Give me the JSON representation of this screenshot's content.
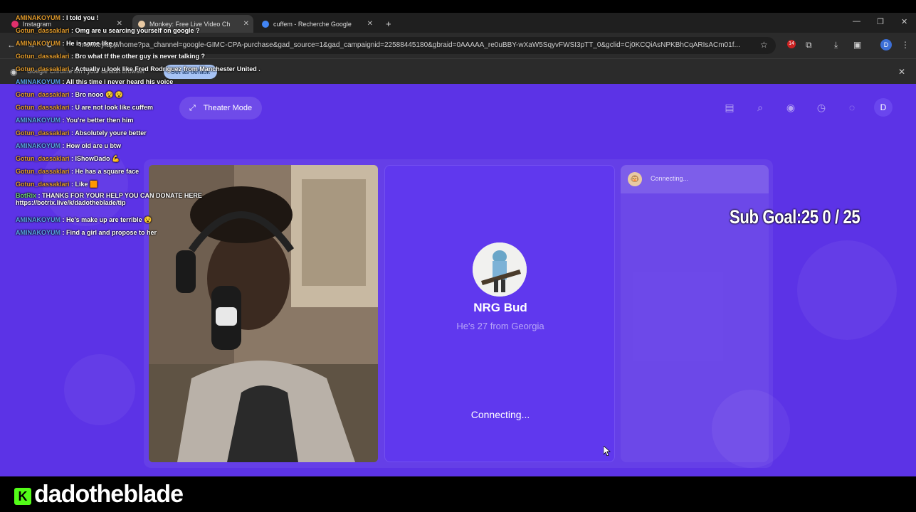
{
  "browser": {
    "tabs": [
      {
        "title": "Instagram",
        "active": false,
        "icon": "instagram-icon",
        "icon_color": "#e1306c"
      },
      {
        "title": "Monkey: Free Live Video Ch",
        "active": true,
        "icon": "monkey-icon",
        "icon_color": "#e8c9a3"
      },
      {
        "title": "cuffem - Recherche Google",
        "active": false,
        "icon": "google-icon",
        "icon_color": "#4285f4"
      }
    ],
    "new_tab": "+",
    "url": "monkey.app/home?pa_channel=google-GIMC-CPA-purchase&gad_source=1&gad_campaignid=22588445180&gbraid=0AAAAA_re0uBBY-wXaW5SqyvFWSI3pTT_0&gclid=Cj0KCQiAsNPKBhCqARIsACm01f...",
    "extension_badge": "14",
    "profile_initial": "D",
    "infobar_text": "Google Chrome isn't your default browser",
    "infobar_button": "Set as default"
  },
  "site": {
    "theater_label": "Theater Mode",
    "avatar_initial": "D",
    "peer": {
      "name": "NRG Bud",
      "subtitle": "He's 27 from Georgia",
      "status": "Connecting..."
    },
    "side_status": "Connecting..."
  },
  "overlay": {
    "chat": [
      {
        "user": "AMINAKOYUM",
        "msg": "I told you !",
        "uc": "u1"
      },
      {
        "user": "Gotun_dassaklari",
        "msg": "Omg are u searcing yourself on google ?",
        "uc": "u1"
      },
      {
        "user": "AMINAKOYUM",
        "msg": "He is same like u",
        "uc": "u1"
      },
      {
        "user": "Gotun_dassaklari",
        "msg": "Bro what tf the other guy is never talking ?",
        "uc": "u1"
      },
      {
        "user": "Gotun_dassaklari",
        "msg": "Actually u look like Fred Rodriguez from Manchester United .",
        "uc": "u1"
      },
      {
        "user": "AMINAKOYUM",
        "msg": "All this time i never heard his voice",
        "uc": "u2"
      },
      {
        "user": "Gotun_dassaklari",
        "msg": "Bro nooo 😵 😵",
        "uc": "u1"
      },
      {
        "user": "Gotun_dassaklari",
        "msg": "U are not look like cuffem",
        "uc": "u1"
      },
      {
        "user": "AMINAKOYUM",
        "msg": "You're better then him",
        "uc": "u2"
      },
      {
        "user": "Gotun_dassaklari",
        "msg": "Absolutely youre better",
        "uc": "u1"
      },
      {
        "user": "AMINAKOYUM",
        "msg": "How old are u btw",
        "uc": "u2"
      },
      {
        "user": "Gotun_dassaklari",
        "msg": "IShowDado 💪",
        "uc": "u1"
      },
      {
        "user": "Gotun_dassaklari",
        "msg": "He has a square face",
        "uc": "u1"
      },
      {
        "user": "Gotun_dassaklari",
        "msg": "Like 🟧",
        "uc": "u1"
      },
      {
        "user": "BotRix",
        "msg": "THANKS FOR YOUR HELP YOU CAN DONATE HERE",
        "msg2": "https://botrix.live/k/dadotheblade/tip",
        "uc": "u3"
      },
      {
        "user": "AMINAKOYUM",
        "msg": "He's make up are terrible 😵",
        "uc": "u2"
      },
      {
        "user": "AMINAKOYUM",
        "msg": "Find a girl and propose to her",
        "uc": "u2"
      }
    ],
    "sub_goal": "Sub Goal:25  0 / 25",
    "streamer": "dadotheblade",
    "kick_glyph": "K"
  },
  "colors": {
    "site_bg": "#5c33e6",
    "kick_green": "#53fc18"
  }
}
